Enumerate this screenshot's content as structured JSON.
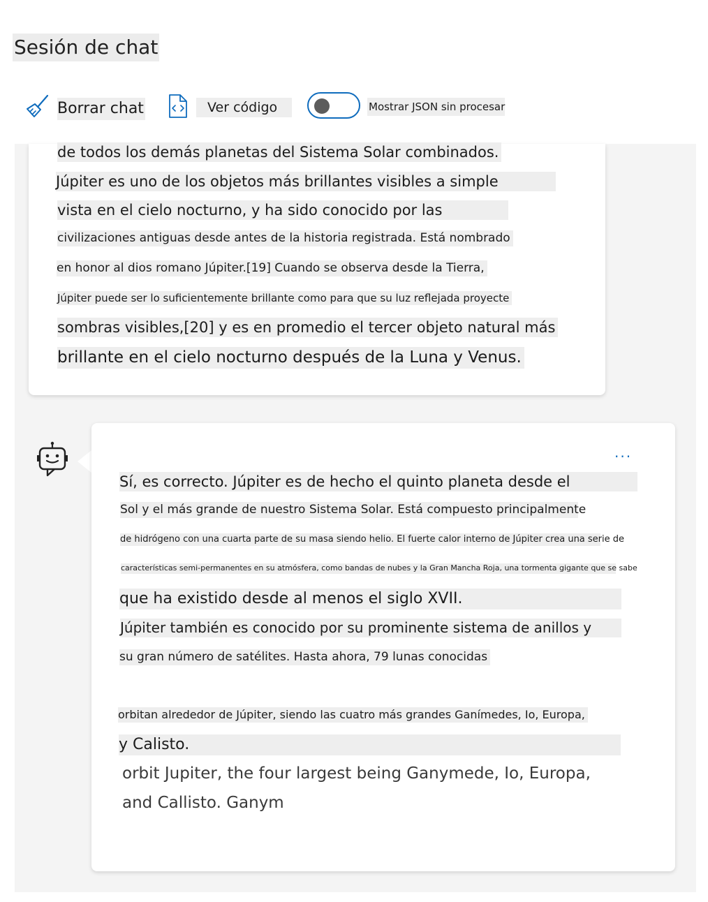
{
  "header": {
    "title": "Sesión de chat"
  },
  "toolbar": {
    "clear_label": "Borrar chat",
    "clear_icon": "broom-icon",
    "code_label": "Ver código",
    "code_icon": "code-file-icon",
    "json_toggle_label": "Mostrar JSON sin procesar",
    "json_toggle_on": false
  },
  "colors": {
    "accent": "#0f6cbd",
    "chat_background": "#f4f4f4",
    "text_highlight": "#eeeeee"
  },
  "user_message": {
    "lines": [
      "de todos los demás planetas del Sistema Solar combinados.",
      "Júpiter es uno de los objetos más brillantes visibles a simple",
      "vista en el cielo nocturno, y ha sido conocido por las",
      "civilizaciones antiguas desde antes de la historia registrada. Está nombrado",
      "en honor al dios romano Júpiter.[19] Cuando se observa desde la Tierra,",
      "Júpiter puede ser lo suficientemente brillante como para que su luz reflejada proyecte",
      "sombras visibles,[20] y es en promedio el tercer objeto natural más",
      "brillante en el cielo nocturno después de la Luna y Venus."
    ]
  },
  "bot_message": {
    "avatar_icon": "bot-icon",
    "more_label": "...",
    "lines": [
      "Sí, es correcto. Júpiter es de hecho el quinto planeta desde el",
      "Sol y el más grande de nuestro Sistema Solar. Está compuesto principalmente",
      "de hidrógeno con una cuarta parte de su masa siendo helio. El fuerte calor interno de Júpiter crea una serie de",
      "características semi-permanentes en su atmósfera, como bandas de nubes y la Gran Mancha Roja, una tormenta gigante que se sabe",
      "que ha existido desde al menos el siglo XVII.",
      "Júpiter también es conocido por su prominente sistema de anillos y",
      "su gran número de satélites. Hasta ahora, 79 lunas conocidas",
      "orbitan alrededor de Júpiter, siendo las cuatro más grandes Ganímedes, Io, Europa,",
      "y Calisto."
    ],
    "overlay_lines": [
      "orbit Jupiter, the four largest being Ganymede, Io, Europa,",
      "and Callisto. Ganym"
    ]
  }
}
